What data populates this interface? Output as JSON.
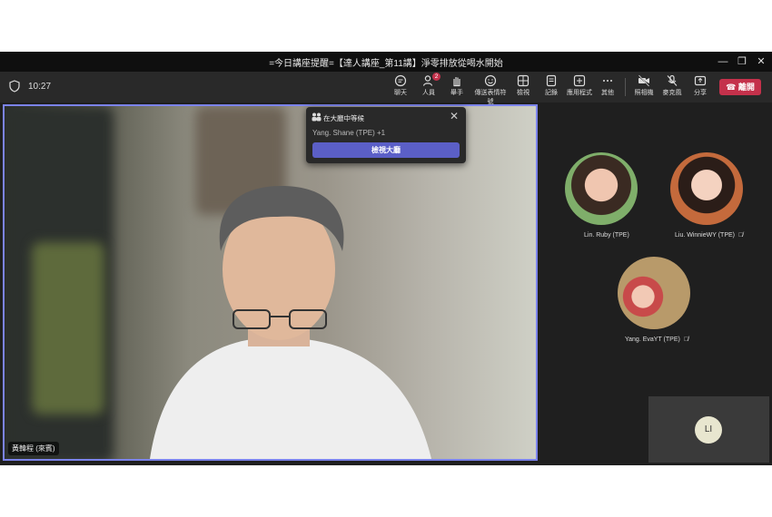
{
  "window": {
    "title": "=今日講座提醒=【達人講座_第11講】淨零排放從喝水開始",
    "controls": [
      "—",
      "❐",
      "✕"
    ]
  },
  "toolbar": {
    "time": "10:27",
    "buttons": [
      {
        "label": "聊天",
        "icon": "chat-icon"
      },
      {
        "label": "人員",
        "icon": "people-icon",
        "badge": "2"
      },
      {
        "label": "舉手",
        "icon": "raise-hand-icon"
      },
      {
        "label": "傳送表情符號",
        "icon": "emoji-icon"
      },
      {
        "label": "檢視",
        "icon": "view-icon"
      },
      {
        "label": "記錄",
        "icon": "notes-icon"
      },
      {
        "label": "應用程式",
        "icon": "apps-icon"
      },
      {
        "label": "其他",
        "icon": "more-icon"
      },
      {
        "label": "照相機",
        "icon": "camera-icon"
      },
      {
        "label": "麥克風",
        "icon": "mic-icon"
      },
      {
        "label": "分享",
        "icon": "share-icon"
      }
    ],
    "leave_label": "離開"
  },
  "stage": {
    "name_tag": "黃韓程 (來賓)"
  },
  "lobby": {
    "header": "在大廳中等候",
    "waiting": "Yang. Shane (TPE) +1",
    "button_label": "檢視大廳"
  },
  "participants": [
    {
      "name": "Lin. Ruby (TPE)",
      "muted": false
    },
    {
      "name": "Liu. WinnieWY (TPE)",
      "muted": true
    },
    {
      "name": "Yang. EvaYT (TPE)",
      "muted": true
    }
  ],
  "self_tile": {
    "initials": "LI"
  }
}
